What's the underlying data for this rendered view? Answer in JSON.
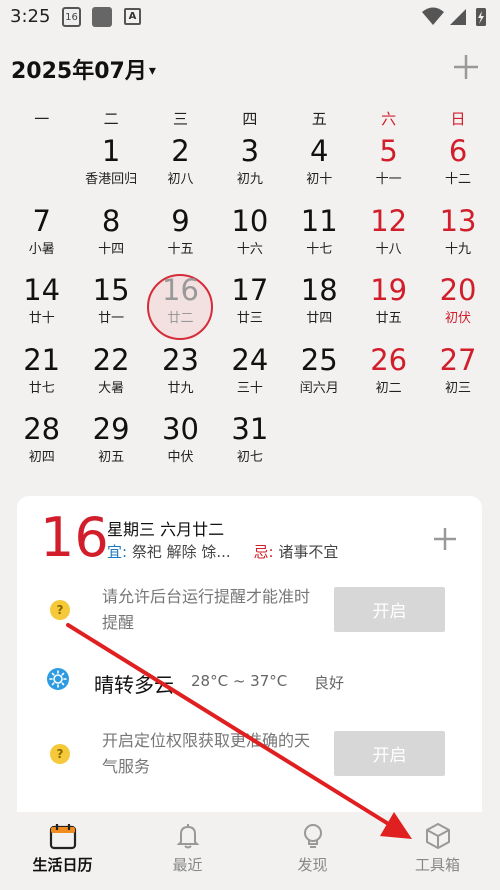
{
  "status_bar": {
    "time": "3:25",
    "calendar_notif_day": "16",
    "keyboard_letter": "A",
    "icons": [
      "calendar-notification-icon",
      "app-notification-icon",
      "input-method-icon",
      "wifi-icon",
      "signal-icon",
      "battery-charging-icon"
    ]
  },
  "header": {
    "title": "2025年07月",
    "caret": "▾"
  },
  "weekdays": [
    "一",
    "二",
    "三",
    "四",
    "五",
    "六",
    "日"
  ],
  "days": [
    {
      "n": "",
      "l": ""
    },
    {
      "n": "1",
      "l": "香港回归"
    },
    {
      "n": "2",
      "l": "初八"
    },
    {
      "n": "3",
      "l": "初九"
    },
    {
      "n": "4",
      "l": "初十"
    },
    {
      "n": "5",
      "l": "十一"
    },
    {
      "n": "6",
      "l": "十二"
    },
    {
      "n": "7",
      "l": "小暑"
    },
    {
      "n": "8",
      "l": "十四"
    },
    {
      "n": "9",
      "l": "十五"
    },
    {
      "n": "10",
      "l": "十六"
    },
    {
      "n": "11",
      "l": "十七"
    },
    {
      "n": "12",
      "l": "十八"
    },
    {
      "n": "13",
      "l": "十九"
    },
    {
      "n": "14",
      "l": "廿十"
    },
    {
      "n": "15",
      "l": "廿一"
    },
    {
      "n": "16",
      "l": "廿二"
    },
    {
      "n": "17",
      "l": "廿三"
    },
    {
      "n": "18",
      "l": "廿四"
    },
    {
      "n": "19",
      "l": "廿五"
    },
    {
      "n": "20",
      "l": "初伏"
    },
    {
      "n": "21",
      "l": "廿七"
    },
    {
      "n": "22",
      "l": "大暑"
    },
    {
      "n": "23",
      "l": "廿九"
    },
    {
      "n": "24",
      "l": "三十"
    },
    {
      "n": "25",
      "l": "闰六月"
    },
    {
      "n": "26",
      "l": "初二"
    },
    {
      "n": "27",
      "l": "初三"
    },
    {
      "n": "28",
      "l": "初四"
    },
    {
      "n": "29",
      "l": "初五"
    },
    {
      "n": "30",
      "l": "中伏"
    },
    {
      "n": "31",
      "l": "初七"
    }
  ],
  "selected_day": "16",
  "holiday_lunar_labels": [
    "初伏"
  ],
  "card": {
    "big_day": "16",
    "day_info": "星期三 六月廿二",
    "yi_label": "宜:",
    "yi_text": "祭祀 解除 馀...",
    "ji_label": "忌:",
    "ji_text": "诸事不宜",
    "reminder_msg": "请允许后台运行提醒才能准时提醒",
    "reminder_button": "开启",
    "weather": "晴转多云",
    "temperature": "28°C ~ 37°C",
    "air_quality": "良好",
    "location_msg": "开启定位权限获取更准确的天气服务",
    "location_button": "开启"
  },
  "nav": [
    {
      "label": "生活日历",
      "icon": "calendar-icon",
      "active": true
    },
    {
      "label": "最近",
      "icon": "bell-icon",
      "active": false
    },
    {
      "label": "发现",
      "icon": "lightbulb-icon",
      "active": false
    },
    {
      "label": "工具箱",
      "icon": "box-icon",
      "active": false
    }
  ],
  "colors": {
    "accent_red": "#d21e2b",
    "yi_blue": "#1c79c0",
    "background": "#f2f1f0",
    "card": "#ffffff",
    "button_disabled": "#d7d7d7",
    "arrow": "#e02020"
  }
}
